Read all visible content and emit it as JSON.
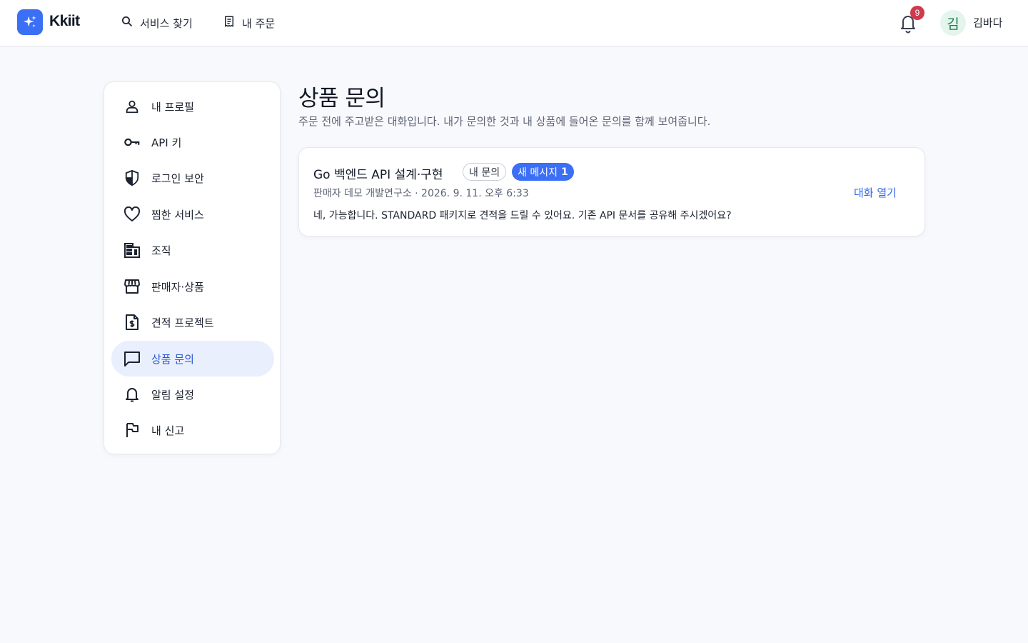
{
  "app": {
    "name": "Kkiit",
    "accent": "#3b6ff5"
  },
  "header": {
    "nav": [
      {
        "label": "서비스 찾기",
        "icon": "search-icon"
      },
      {
        "label": "내 주문",
        "icon": "receipt-icon"
      }
    ],
    "notifications": {
      "count": "9",
      "icon": "bell-icon"
    },
    "user": {
      "avatar_initial": "김",
      "name": "김바다"
    }
  },
  "sidebar": {
    "items": [
      {
        "label": "내 프로필",
        "icon": "user-icon"
      },
      {
        "label": "API 키",
        "icon": "key-icon"
      },
      {
        "label": "로그인 보안",
        "icon": "shield-icon"
      },
      {
        "label": "찜한 서비스",
        "icon": "heart-icon"
      },
      {
        "label": "조직",
        "icon": "building-icon"
      },
      {
        "label": "판매자·상품",
        "icon": "store-icon"
      },
      {
        "label": "견적 프로젝트",
        "icon": "invoice-icon"
      },
      {
        "label": "상품 문의",
        "icon": "chat-icon",
        "active": true
      },
      {
        "label": "알림 설정",
        "icon": "bell-icon"
      },
      {
        "label": "내 신고",
        "icon": "flag-icon"
      }
    ]
  },
  "main": {
    "title": "상품 문의",
    "subtitle": "주문 전에 주고받은 대화입니다. 내가 문의한 것과 내 상품에 들어온 문의를 함께 보여줍니다.",
    "inquiries": [
      {
        "title": "Go 백엔드 API 설계·구현",
        "tag_mine": "내 문의",
        "tag_new": "새 메시지",
        "new_count": "1",
        "meta": "판매자 데모 개발연구소 · 2026. 9. 11. 오후 6:33",
        "open_label": "대화 열기",
        "message": "네, 가능합니다. STANDARD 패키지로 견적을 드릴 수 있어요. 기존 API 문서를 공유해 주시겠어요?"
      }
    ]
  }
}
